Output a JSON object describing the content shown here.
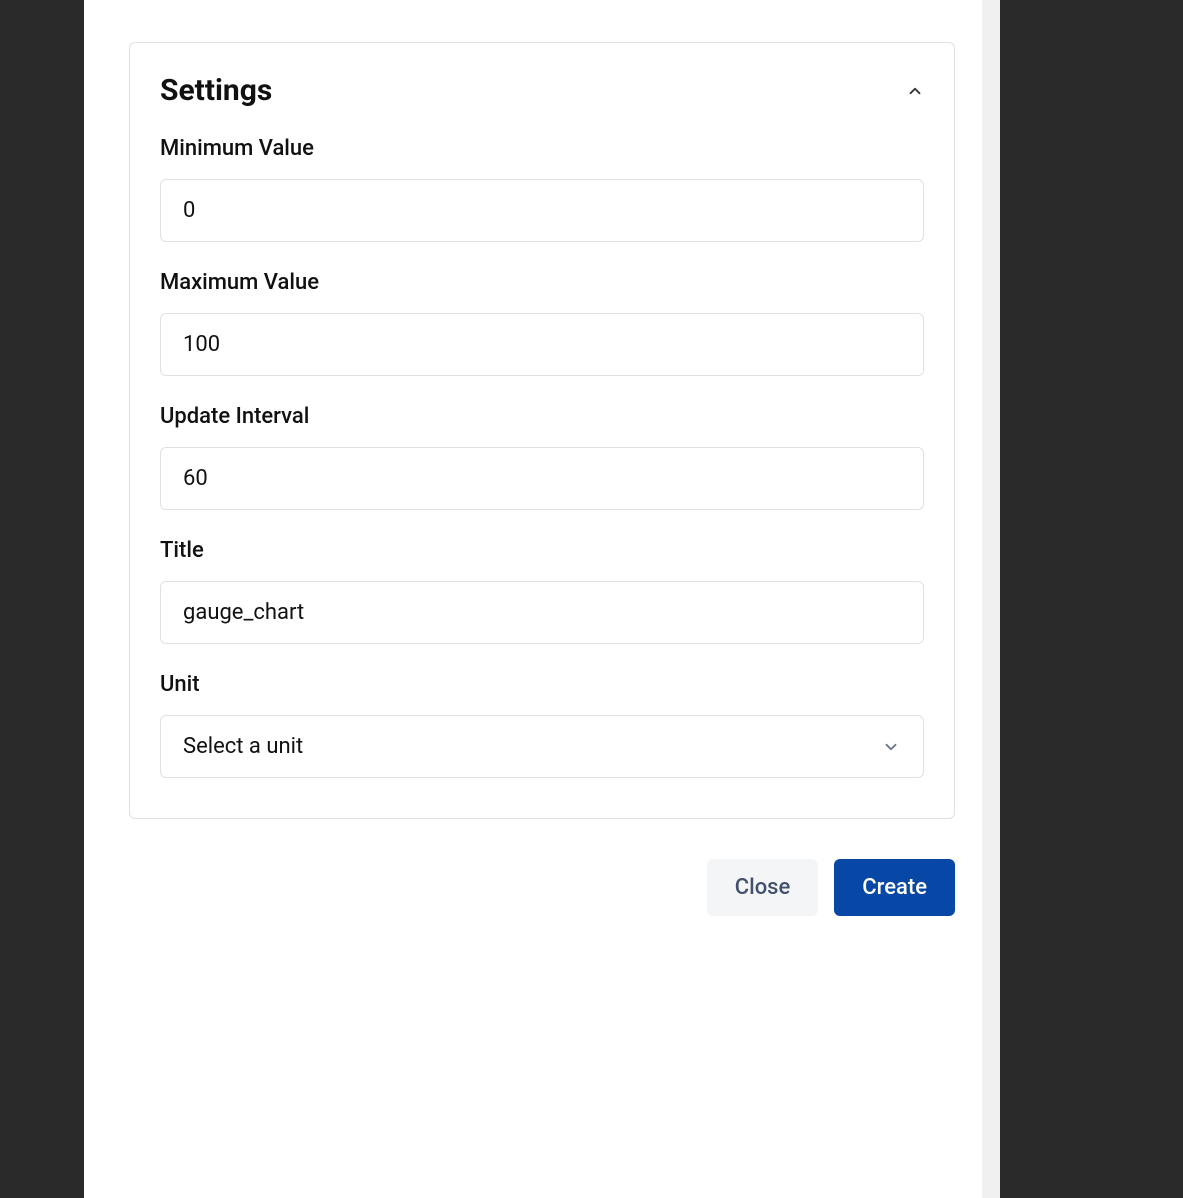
{
  "settings": {
    "title": "Settings",
    "fields": {
      "minimum_value": {
        "label": "Minimum Value",
        "value": "0"
      },
      "maximum_value": {
        "label": "Maximum Value",
        "value": "100"
      },
      "update_interval": {
        "label": "Update Interval",
        "value": "60"
      },
      "title_field": {
        "label": "Title",
        "value": "gauge_chart"
      },
      "unit": {
        "label": "Unit",
        "selected": "Select a unit"
      }
    }
  },
  "footer": {
    "close_label": "Close",
    "create_label": "Create"
  }
}
